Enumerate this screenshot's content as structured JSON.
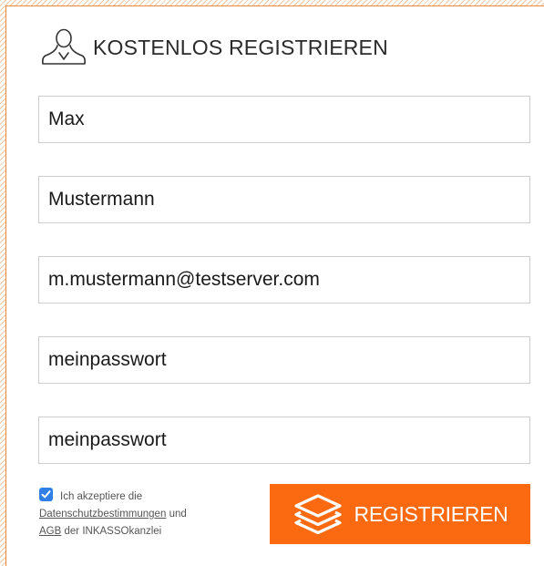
{
  "header": {
    "icon": "user-outline-icon",
    "title": "KOSTENLOS REGISTRIEREN"
  },
  "form": {
    "first_name": "Max",
    "last_name": "Mustermann",
    "email": "m.mustermann@testserver.com",
    "password": "meinpasswort",
    "password_confirm": "meinpasswort"
  },
  "consent": {
    "checked": true,
    "text_before": "Ich akzeptiere die",
    "privacy_link": "Datenschutzbestimmungen",
    "text_and": "und",
    "terms_link": "AGB",
    "text_after": "der INKASSOkanzlei"
  },
  "submit": {
    "icon": "layers-icon",
    "label": "REGISTRIEREN",
    "color": "#fb6a11"
  }
}
